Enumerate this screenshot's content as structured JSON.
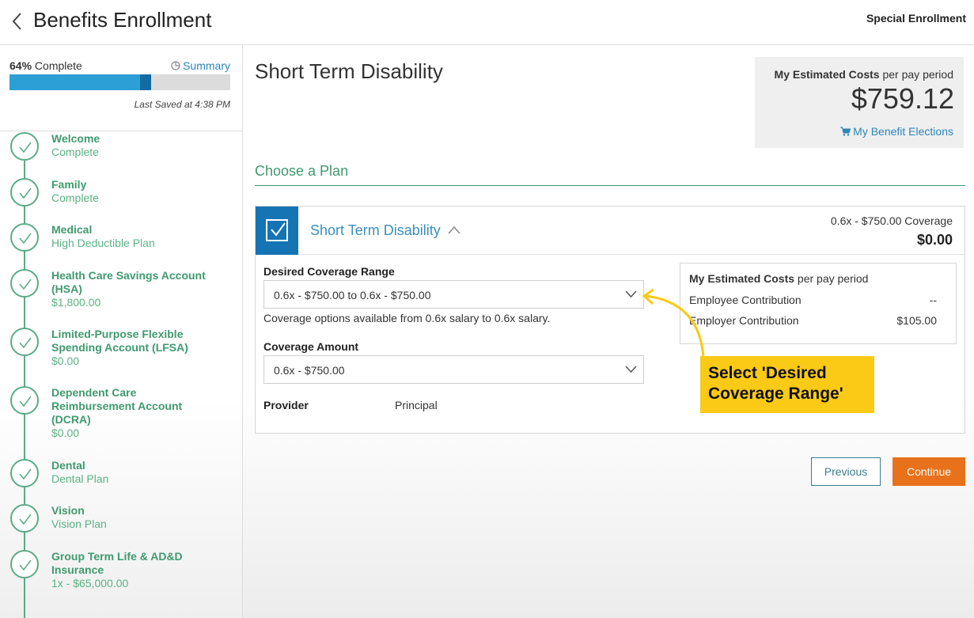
{
  "header": {
    "title": "Benefits Enrollment",
    "mode": "Special Enrollment"
  },
  "progress": {
    "percent_value": 0.64,
    "percent_label": "64%",
    "complete_label": "Complete",
    "summary_label": "Summary",
    "last_saved": "Last Saved at 4:38 PM"
  },
  "steps": [
    {
      "title": "Welcome",
      "sub": "Complete"
    },
    {
      "title": "Family",
      "sub": "Complete"
    },
    {
      "title": "Medical",
      "sub": "High Deductible Plan"
    },
    {
      "title": "Health Care Savings Account (HSA)",
      "sub": "$1,800.00"
    },
    {
      "title": "Limited-Purpose Flexible Spending Account (LFSA)",
      "sub": "$0.00"
    },
    {
      "title": "Dependent Care Reimbursement Account (DCRA)",
      "sub": "$0.00"
    },
    {
      "title": "Dental",
      "sub": "Dental Plan"
    },
    {
      "title": "Vision",
      "sub": "Vision Plan"
    },
    {
      "title": "Group Term Life & AD&D Insurance",
      "sub": "1x - $65,000.00"
    }
  ],
  "main": {
    "page_title": "Short Term Disability",
    "costs": {
      "label_bold": "My Estimated Costs",
      "label_rest": " per pay period",
      "amount": "$759.12",
      "elections_link": "My Benefit Elections"
    },
    "choose_heading": "Choose a Plan",
    "plan": {
      "name": "Short Term Disability",
      "coverage_summary": "0.6x - $750.00 Coverage",
      "price": "$0.00",
      "range_label": "Desired Coverage Range",
      "range_value": "0.6x - $750.00 to 0.6x - $750.00",
      "range_hint": "Coverage options available from 0.6x salary to 0.6x salary.",
      "amount_label": "Coverage Amount",
      "amount_value": "0.6x - $750.00",
      "provider_label": "Provider",
      "provider_value": "Principal",
      "estimate": {
        "title_bold": "My Estimated Costs",
        "title_rest": " per pay period",
        "rows": [
          {
            "label": "Employee Contribution",
            "value": "--"
          },
          {
            "label": "Employer Contribution",
            "value": "$105.00"
          }
        ]
      }
    },
    "callout": {
      "line1": "Select 'Desired",
      "line2": "Coverage Range'"
    },
    "buttons": {
      "previous": "Previous",
      "continue": "Continue"
    }
  },
  "colors": {
    "green": "#3f9a6e",
    "blue": "#1474b4",
    "orange": "#e8711b",
    "callout": "#fbca16"
  },
  "icons": {
    "back": "chevron-left-icon",
    "summary": "pie-chart-icon",
    "cart": "cart-icon",
    "check": "check-icon",
    "chevron_up": "chevron-up-icon",
    "chevron_down": "chevron-down-icon"
  }
}
